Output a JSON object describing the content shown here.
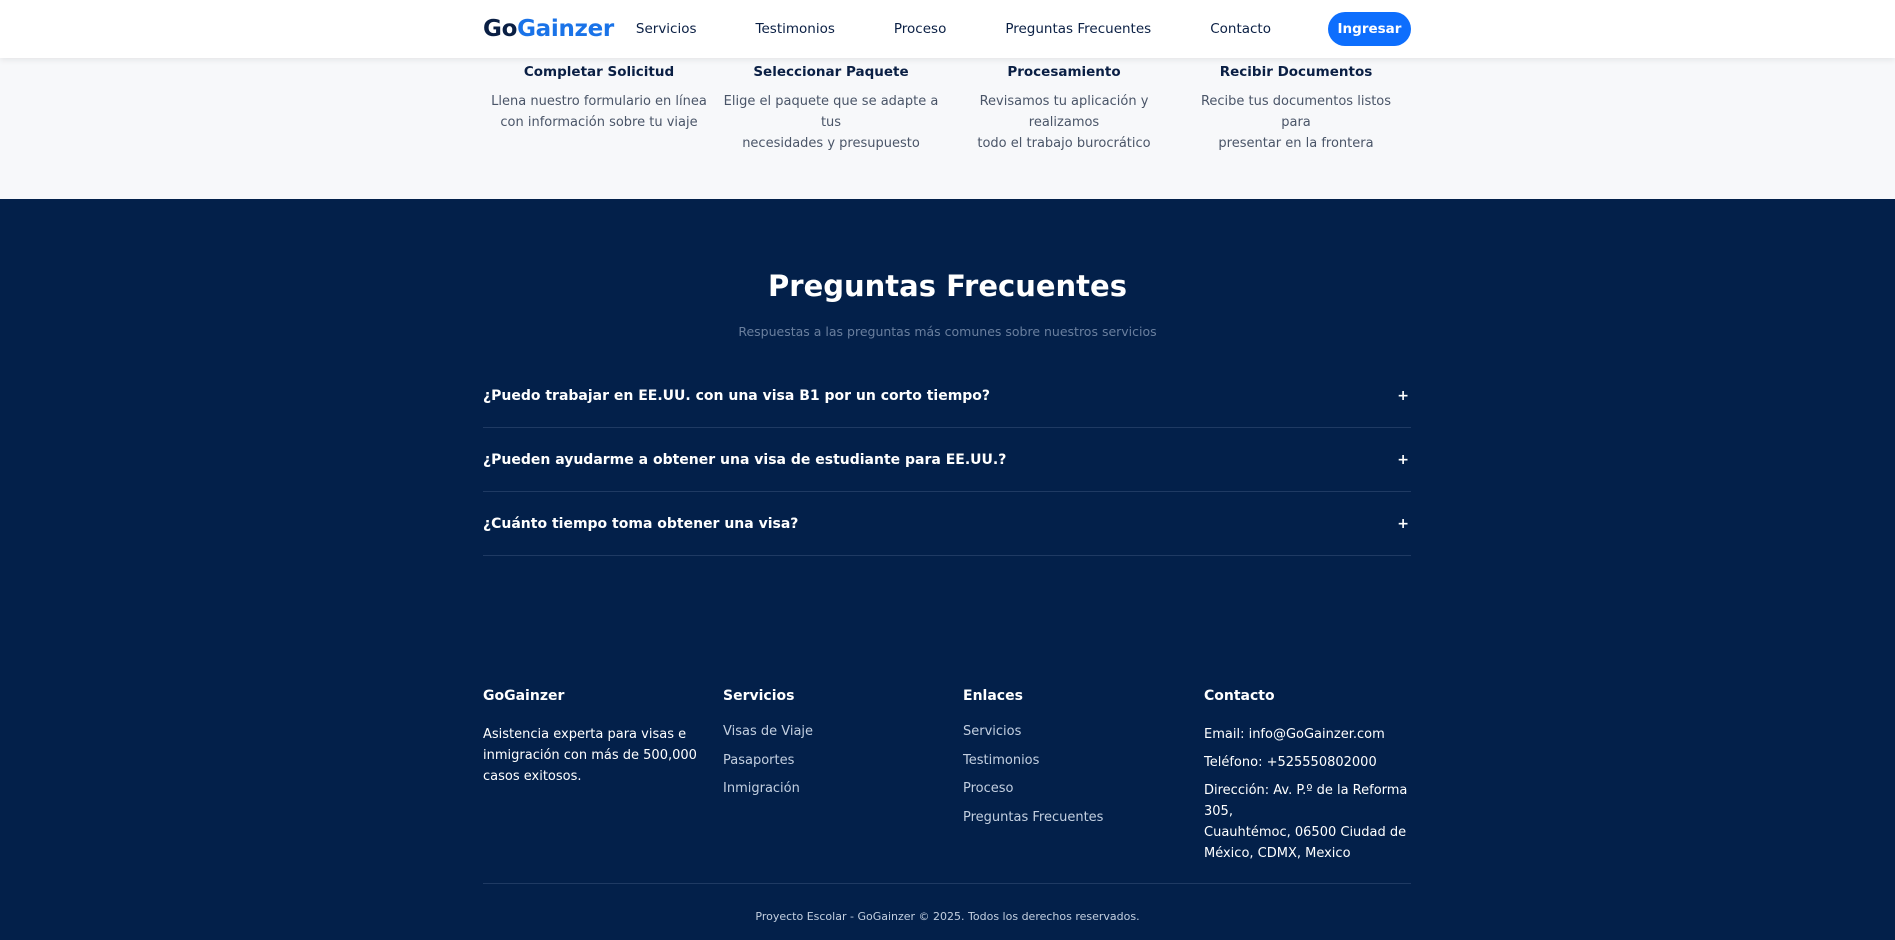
{
  "brand": {
    "go": "Go",
    "gainzer": "Gainzer"
  },
  "nav": {
    "links": [
      "Servicios",
      "Testimonios",
      "Proceso",
      "Preguntas Frecuentes",
      "Contacto"
    ],
    "login_label": "Ingresar"
  },
  "process": {
    "steps": [
      {
        "title": "Completar Solicitud",
        "desc1": "Llena nuestro formulario en línea",
        "desc2": "con información sobre tu viaje"
      },
      {
        "title": "Seleccionar Paquete",
        "desc1": "Elige el paquete que se adapte a tus",
        "desc2": "necesidades y presupuesto"
      },
      {
        "title": "Procesamiento",
        "desc1": "Revisamos tu aplicación y realizamos",
        "desc2": "todo el trabajo burocrático"
      },
      {
        "title": "Recibir Documentos",
        "desc1": "Recibe tus documentos listos para",
        "desc2": "presentar en la frontera"
      }
    ]
  },
  "faq": {
    "title": "Preguntas Frecuentes",
    "subtitle": "Respuestas a las preguntas más comunes sobre nuestros servicios",
    "expand_symbol": "+",
    "items": [
      "¿Puedo trabajar en EE.UU. con una visa B1 por un corto tiempo?",
      "¿Pueden ayudarme a obtener una visa de estudiante para EE.UU.?",
      "¿Cuánto tiempo toma obtener una visa?"
    ]
  },
  "footer": {
    "about": {
      "title": "GoGainzer",
      "text1": "Asistencia experta para visas e",
      "text2": "inmigración con más de 500,000",
      "text3": "casos exitosos."
    },
    "services": {
      "title": "Servicios",
      "links": [
        "Visas de Viaje",
        "Pasaportes",
        "Inmigración"
      ]
    },
    "links": {
      "title": "Enlaces",
      "links": [
        "Servicios",
        "Testimonios",
        "Proceso",
        "Preguntas Frecuentes"
      ]
    },
    "contact": {
      "title": "Contacto",
      "email": "Email: info@GoGainzer.com",
      "phone": "Teléfono: +525550802000",
      "address1": "Dirección: Av. P.º de la Reforma 305,",
      "address2": "Cuauhtémoc, 06500 Ciudad de",
      "address3": "México, CDMX, Mexico"
    },
    "copyright": "Proyecto Escolar - GoGainzer © 2025. Todos los derechos reservados."
  }
}
